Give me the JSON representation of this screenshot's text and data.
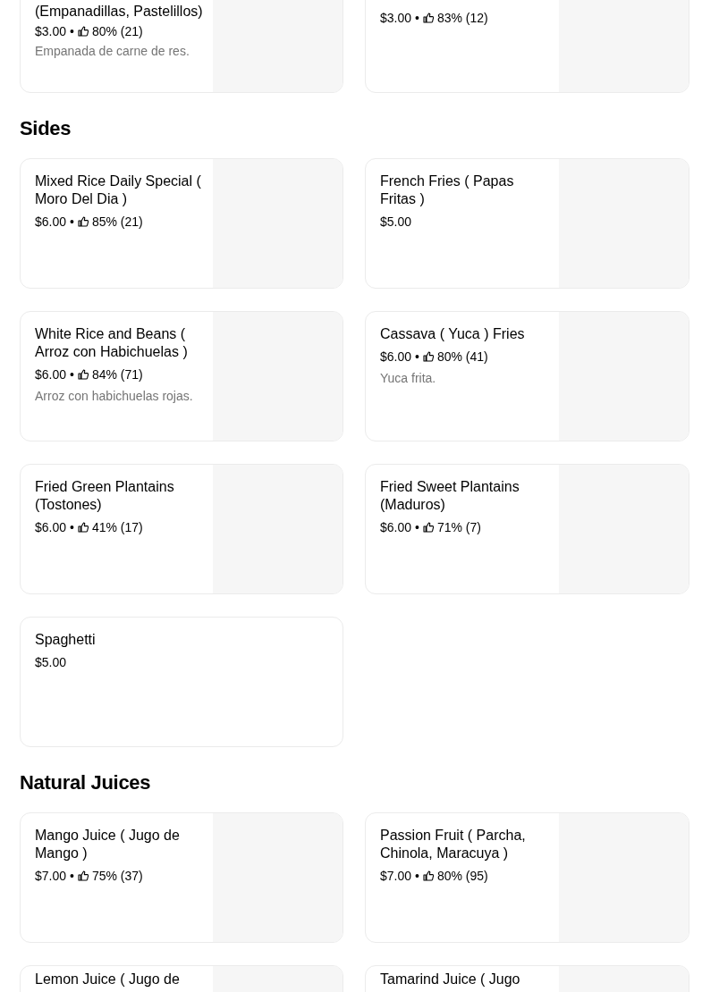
{
  "separator": "•",
  "sections": [
    {
      "items": [
        {
          "name": "(Empanadillas, Pastelillos)",
          "price": "$3.00",
          "rating": "80% (21)",
          "description": "Empanada de carne de res.",
          "has_image": true
        },
        {
          "price": "$3.00",
          "rating": "83% (12)",
          "has_image": true
        }
      ]
    },
    {
      "title": "Sides",
      "items": [
        {
          "name": "Mixed Rice Daily Special ( Moro Del Dia )",
          "price": "$6.00",
          "rating": "85% (21)",
          "has_image": true
        },
        {
          "name": "French Fries ( Papas Fritas )",
          "price": "$5.00",
          "has_image": true
        },
        {
          "name": "White Rice and Beans ( Arroz con Habichuelas )",
          "price": "$6.00",
          "rating": "84% (71)",
          "description": "Arroz con habichuelas rojas.",
          "has_image": true
        },
        {
          "name": "Cassava ( Yuca ) Fries",
          "price": "$6.00",
          "rating": "80% (41)",
          "description": "Yuca frita.",
          "has_image": true
        },
        {
          "name": "Fried Green Plantains (Tostones)",
          "price": "$6.00",
          "rating": "41% (17)",
          "has_image": true
        },
        {
          "name": "Fried Sweet Plantains (Maduros)",
          "price": "$6.00",
          "rating": "71% (7)",
          "has_image": true
        },
        {
          "name": "Spaghetti",
          "price": "$5.00",
          "has_image": false
        }
      ]
    },
    {
      "title": "Natural Juices",
      "items": [
        {
          "name": "Mango Juice  ( Jugo de Mango )",
          "price": "$7.00",
          "rating": "75% (37)",
          "has_image": true
        },
        {
          "name": "Passion Fruit ( Parcha, Chinola, Maracuya )",
          "price": "$7.00",
          "rating": "80% (95)",
          "has_image": true
        },
        {
          "name": "Lemon Juice ( Jugo de",
          "has_image": true
        },
        {
          "name": "Tamarind Juice ( Jugo",
          "has_image": true
        }
      ]
    }
  ]
}
